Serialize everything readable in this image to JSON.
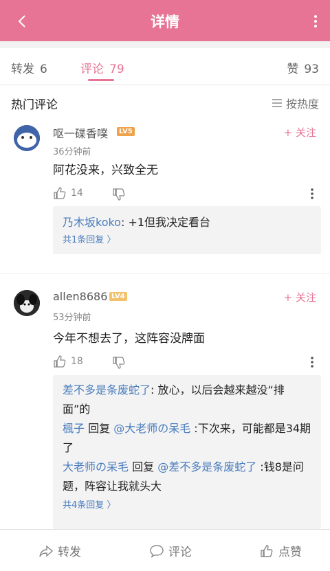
{
  "header": {
    "title": "详情"
  },
  "tabs": [
    {
      "label": "转发",
      "count": "6"
    },
    {
      "label": "评论",
      "count": "79"
    },
    {
      "label": "赞",
      "count": "93"
    }
  ],
  "section": {
    "title": "热门评论",
    "sort_label": "按热度"
  },
  "comments": [
    {
      "user": "呕一碟香噗",
      "level": "LV5",
      "follow": "+ 关注",
      "time": "36分钟前",
      "text": "阿花没来，兴致全无",
      "likes": "14",
      "replies": [
        {
          "name": "乃木坂koko",
          "text": ": +1但我决定看台"
        }
      ],
      "more_replies": "共1条回复 〉"
    },
    {
      "user": "allen8686",
      "level": "LV4",
      "follow": "+ 关注",
      "time": "53分钟前",
      "text": "今年不想去了，这阵容没牌面",
      "likes": "18",
      "replies": [
        {
          "name": "差不多是条废蛇了",
          "text": ": 放心，以后会越来越没“排面”的"
        },
        {
          "name": "楓子",
          "reply_word": " 回复 ",
          "target": "@大老师の呆毛",
          "text": " :下次来，可能都是34期了"
        },
        {
          "name": "大老师の呆毛",
          "reply_word": " 回复 ",
          "target": "@差不多是条废蛇了",
          "text": " :钱8是问题，阵容让我就头大"
        }
      ],
      "more_replies": "共4条回复 〉"
    }
  ],
  "bottom": {
    "repost": "转发",
    "comment": "评论",
    "like": "点赞"
  },
  "colors": {
    "brand": "#e77494",
    "link": "#4a7cbd",
    "lv5": "#f0a24a",
    "lv4": "#f2c26b"
  }
}
